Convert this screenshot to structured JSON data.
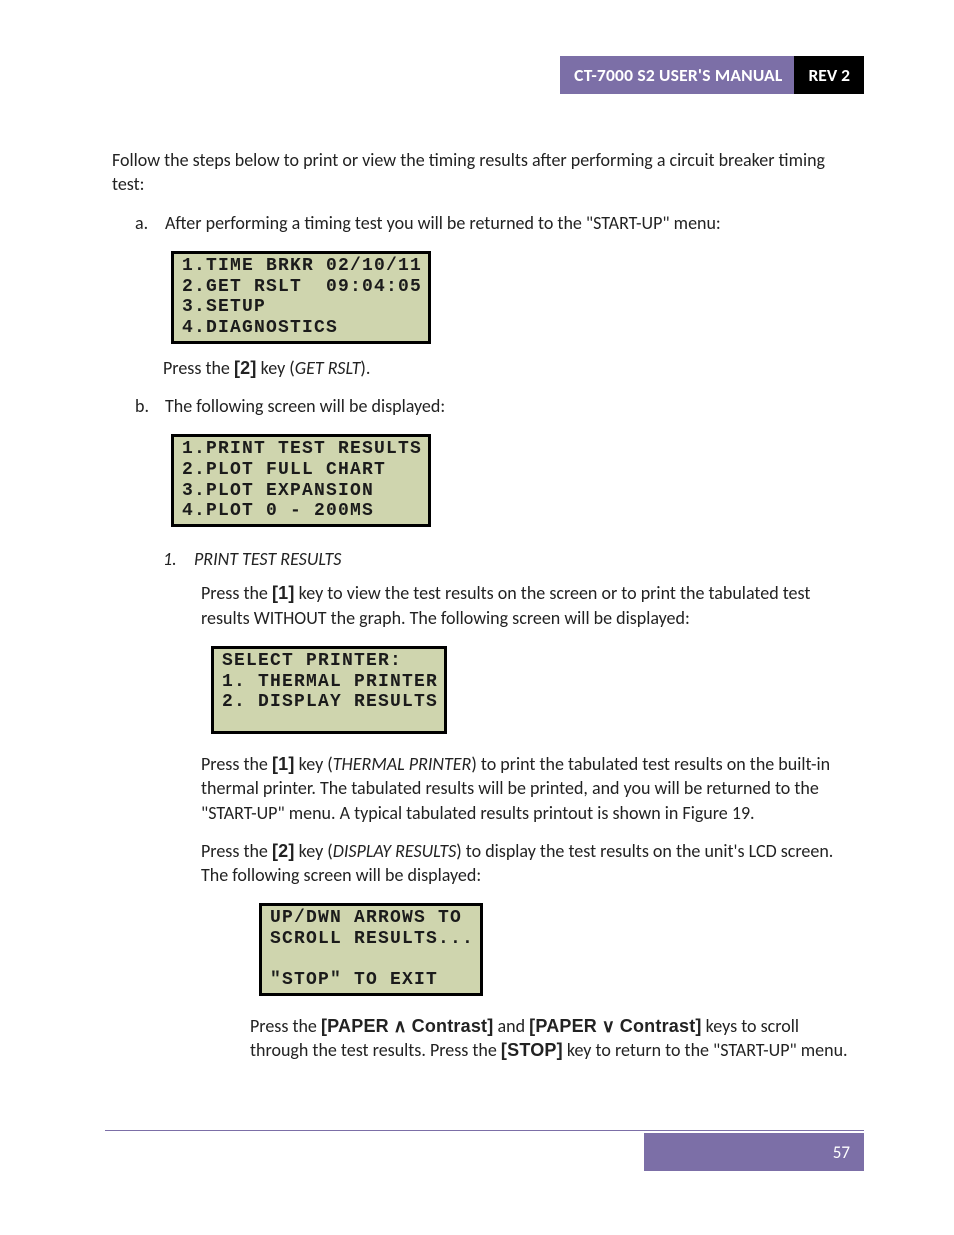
{
  "header": {
    "manual_title": "CT-7000 S2 USER'S MANUAL",
    "rev": "REV 2"
  },
  "intro": "Follow the steps below to print or view the timing results after performing a circuit breaker timing test:",
  "step_a": {
    "letter": "a.",
    "text": "After performing a timing test you will be returned to the \"START-UP\" menu:",
    "lcd": "1.TIME BRKR 02/10/11\n2.GET RSLT  09:04:05\n3.SETUP\n4.DIAGNOSTICS",
    "press_pre": "Press the ",
    "press_key": "[2]",
    "press_mid": " key (",
    "press_it": "GET RSLT",
    "press_end": ")."
  },
  "step_b": {
    "letter": "b.",
    "text": "The following screen will be displayed:",
    "lcd": "1.PRINT TEST RESULTS\n2.PLOT FULL CHART\n3.PLOT EXPANSION\n4.PLOT 0 - 200MS"
  },
  "opt1": {
    "num": "1.",
    "title": "PRINT TEST RESULTS",
    "p1_a": "Press the ",
    "p1_key": "[1]",
    "p1_b": " key to view the test results on the screen or to print the tabulated test results WITHOUT the graph. The following screen will be displayed:",
    "lcd1": "SELECT PRINTER:\n1. THERMAL PRINTER\n2. DISPLAY RESULTS",
    "p2_a": "Press the ",
    "p2_key": "[1]",
    "p2_b": " key (",
    "p2_it": "THERMAL PRINTER",
    "p2_c": ") to print the tabulated test results on the built-in thermal printer. The tabulated results will be printed, and you will be returned to the \"START-UP\" menu. A typical tabulated results printout is shown in Figure 19.",
    "p3_a": "Press the ",
    "p3_key": "[2]",
    "p3_b": " key (",
    "p3_it": "DISPLAY RESULTS",
    "p3_c": ") to display the test results on the unit's LCD screen. The following screen will be displayed:",
    "lcd2": "UP/DWN ARROWS TO\nSCROLL RESULTS...\n\n\"STOP\" TO EXIT",
    "p4_a": "Press the ",
    "p4_k1a": "[PAPER",
    "p4_sym1": " ∧ ",
    "p4_k1b": "Contrast]",
    "p4_and": " and ",
    "p4_k2a": "[PAPER",
    "p4_sym2": " ∨ ",
    "p4_k2b": "Contrast]",
    "p4_b": " keys to scroll through the test results. Press the ",
    "p4_k3": "[STOP]",
    "p4_c": " key to return to the \"START-UP\" menu."
  },
  "footer": {
    "page": "57"
  }
}
